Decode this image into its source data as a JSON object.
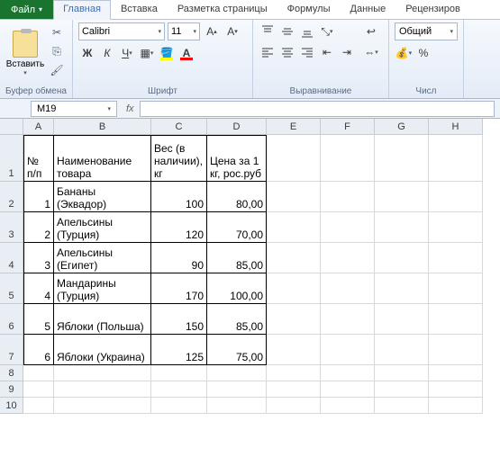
{
  "tabs": {
    "file": "Файл",
    "home": "Главная",
    "insert": "Вставка",
    "layout": "Разметка страницы",
    "formulas": "Формулы",
    "data": "Данные",
    "review": "Рецензиров"
  },
  "ribbon": {
    "clipboard": {
      "paste": "Вставить",
      "title": "Буфер обмена"
    },
    "font": {
      "name": "Calibri",
      "size": "11",
      "title": "Шрифт"
    },
    "align": {
      "title": "Выравнивание"
    },
    "number": {
      "format": "Общий",
      "title": "Числ"
    }
  },
  "namebox": "M19",
  "columns": [
    "A",
    "B",
    "C",
    "D",
    "E",
    "F",
    "G",
    "H"
  ],
  "headers": {
    "A": "№ п/п",
    "B": "Наименование товара",
    "C": "Вес (в наличии), кг",
    "D": "Цена за 1 кг, рос.руб"
  },
  "rows": [
    {
      "n": "1",
      "name": "Бананы (Эквадор)",
      "w": "100",
      "p": "80,00"
    },
    {
      "n": "2",
      "name": "Апельсины (Турция)",
      "w": "120",
      "p": "70,00"
    },
    {
      "n": "3",
      "name": "Апельсины (Египет)",
      "w": "90",
      "p": "85,00"
    },
    {
      "n": "4",
      "name": "Мандарины (Турция)",
      "w": "170",
      "p": "100,00"
    },
    {
      "n": "5",
      "name": "Яблоки (Польша)",
      "w": "150",
      "p": "85,00"
    },
    {
      "n": "6",
      "name": "Яблоки (Украина)",
      "w": "125",
      "p": "75,00"
    }
  ]
}
